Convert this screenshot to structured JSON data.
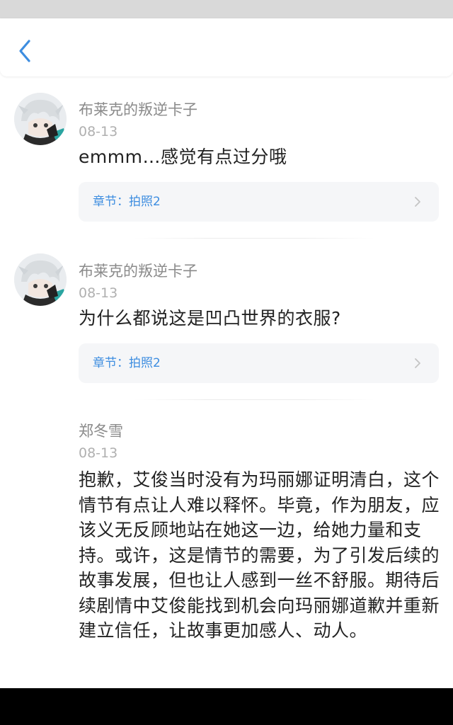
{
  "header": {
    "back_icon": "chevron-left-icon",
    "accent_color": "#3d8de0"
  },
  "comments": [
    {
      "user": "布莱克的叛逆卡子",
      "date": "08-13",
      "text": "emmm…感觉有点过分哦",
      "chapter": "章节：拍照2",
      "has_avatar": true
    },
    {
      "user": "布莱克的叛逆卡子",
      "date": "08-13",
      "text": "为什么都说这是凹凸世界的衣服?",
      "chapter": "章节：拍照2",
      "has_avatar": true
    },
    {
      "user": "郑冬雪",
      "date": "08-13",
      "text": "抱歉，艾俊当时没有为玛丽娜证明清白，这个情节有点让人难以释怀。毕竟，作为朋友，应该义无反顾地站在她这一边，给她力量和支持。或许，这是情节的需要，为了引发后续的故事发展，但也让人感到一丝不舒服。期待后续剧情中艾俊能找到机会向玛丽娜道歉并重新建立信任，让故事更加感人、动人。",
      "has_avatar": false
    }
  ],
  "colors": {
    "name": "#8a8a8a",
    "date": "#b0b0b0",
    "text": "#222222",
    "card_bg": "#f5f6f8",
    "chapter_link": "#3d8de0"
  }
}
